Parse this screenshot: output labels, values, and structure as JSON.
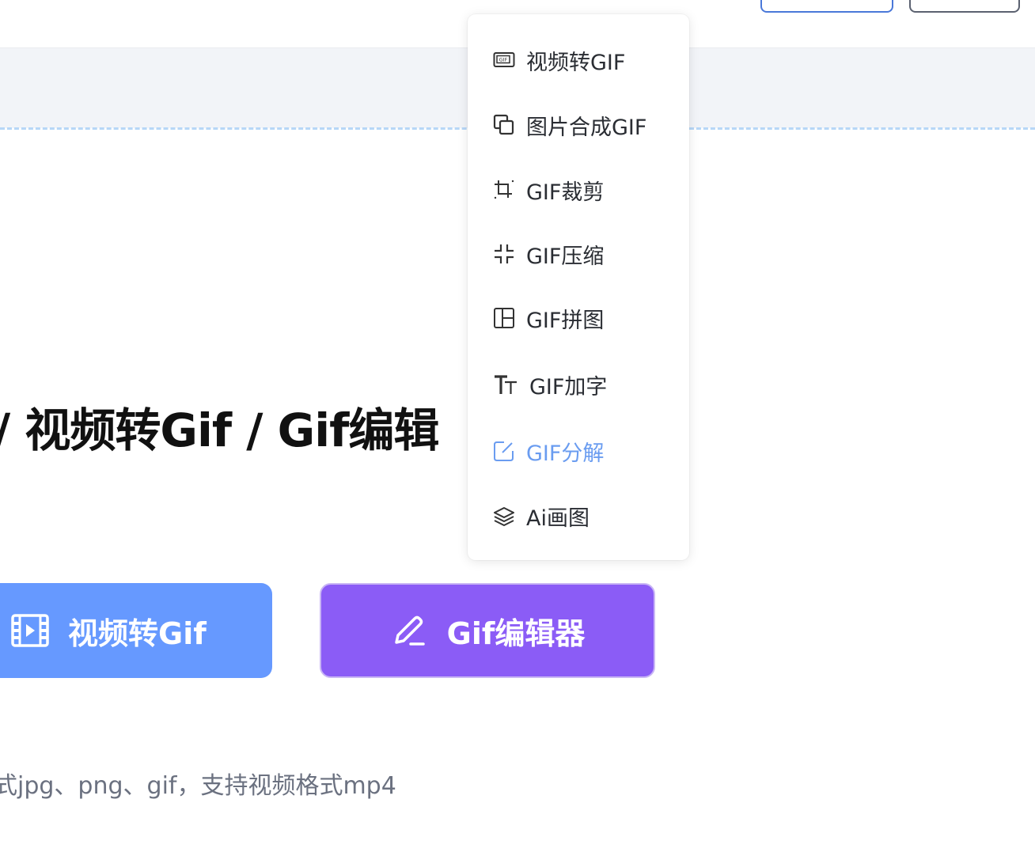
{
  "menu": {
    "items": [
      {
        "label": "视频转GIF",
        "icon": "gif-icon"
      },
      {
        "label": "图片合成GIF",
        "icon": "copy-icon"
      },
      {
        "label": "GIF裁剪",
        "icon": "crop-icon"
      },
      {
        "label": "GIF压缩",
        "icon": "compress-icon"
      },
      {
        "label": "GIF拼图",
        "icon": "layout-icon"
      },
      {
        "label": "GIF加字",
        "icon": "text-size-icon"
      },
      {
        "label": "GIF分解",
        "icon": "edit-square-icon",
        "active": true
      },
      {
        "label": "Ai画图",
        "icon": "layers-icon"
      }
    ],
    "active_color": "#6a9cf0"
  },
  "hero": {
    "title": "/ 视频转Gif / Gif编辑"
  },
  "cta": {
    "video_label": "视频转Gif",
    "editor_label": "Gif编辑器",
    "video_color": "#6699ff",
    "editor_color": "#8b5cf6"
  },
  "note": {
    "formats": "式jpg、png、gif，支持视频格式mp4"
  }
}
